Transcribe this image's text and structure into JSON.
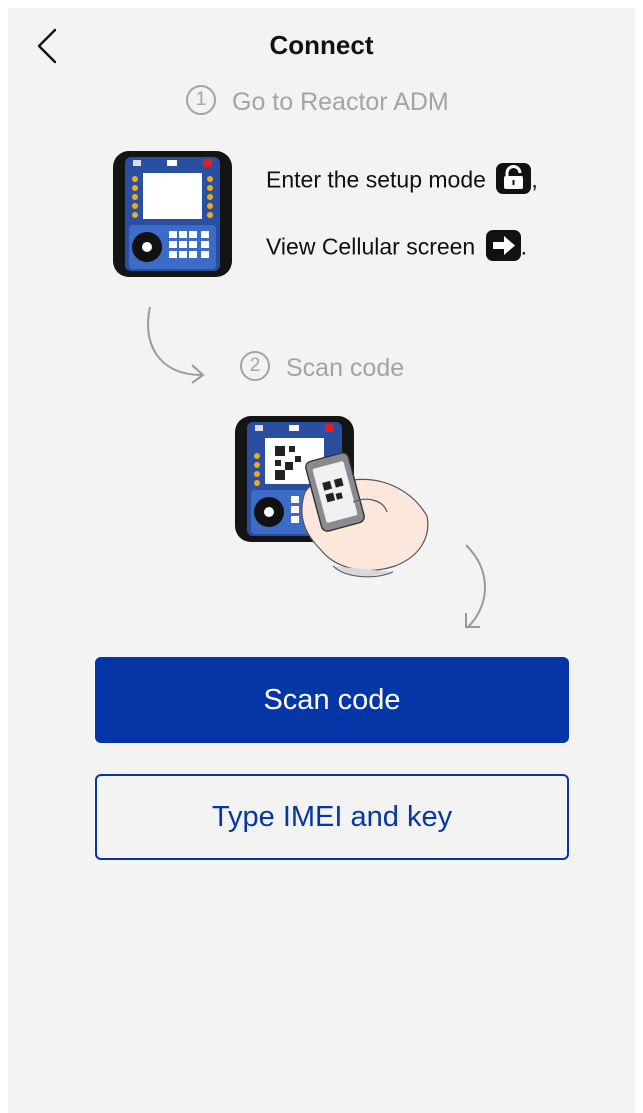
{
  "header": {
    "title": "Connect",
    "back_icon": "chevron-left-icon"
  },
  "steps": [
    {
      "number": "1",
      "label": "Go to Reactor ADM"
    },
    {
      "number": "2",
      "label": "Scan code"
    }
  ],
  "instructions": {
    "line1_text": "Enter the setup mode",
    "line1_icon": "unlock-icon",
    "line1_suffix": ",",
    "line2_text": "View Cellular screen",
    "line2_icon": "arrow-right-icon",
    "line2_suffix": "."
  },
  "buttons": {
    "scan_code": "Scan code",
    "type_imei": "Type IMEI and key"
  },
  "colors": {
    "primary": "#0536a8",
    "background": "#f3f3f4",
    "step_gray": "#a3a3a8",
    "device_blue": "#2a4fa0",
    "led_orange": "#f0a820"
  }
}
